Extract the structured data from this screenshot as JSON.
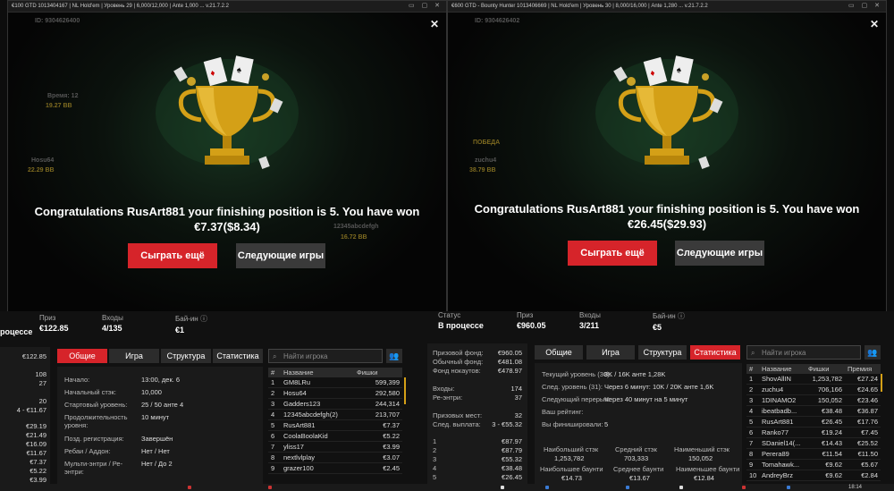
{
  "left_window": {
    "title": "€100 GTD 1013404167 | NL Hold'em | Уровень 29 | 6,000/12,000 | Ante 1,000 ... v.21.7.2.2",
    "id_text": "ID: 9304626400",
    "bg_labels": [
      "Время: 12",
      "19.27 BB",
      "Hosu64",
      "22.29 BB",
      "12345abcdefgh",
      "16.72 BB"
    ],
    "congrats_line1": "Congratulations RusArt881 your finishing position is 5. You have won",
    "congrats_line2": "€7.37($8.34)",
    "play_again": "Сыграть ещё",
    "next_games": "Следующие игры"
  },
  "right_window": {
    "title": "€600 GTD - Bounty Hunter 1013406669 | NL Hold'em | Уровень 30 | 8,000/16,000 | Ante 1,280 ... v.21.7.2.2",
    "id_text": "ID: 9304626402",
    "bg_labels": [
      "ПОБЕДА",
      "zuchu4",
      "38.79 BB"
    ],
    "congrats_line1": "Congratulations RusArt881 your finishing position is 5. You have won",
    "congrats_line2": "€26.45($29.93)",
    "play_again": "Сыграть ещё",
    "next_games": "Следующие игры"
  },
  "left_lobby": {
    "status_partial": "роцессе",
    "prize_label": "Приз",
    "prize_value": "€122.85",
    "entries_label": "Входы",
    "entries_value": "4/135",
    "buyin_label": "Бай-ин",
    "buyin_value": "€1",
    "side_values": [
      "€122.85",
      "108",
      "27",
      "20",
      "4 - €11.67",
      "€29.19",
      "€21.49",
      "€16.09",
      "€11.67",
      "€7.37",
      "€5.22",
      "€3.99"
    ],
    "tabs": [
      "Общие",
      "Игра",
      "Структура",
      "Статистика"
    ],
    "search_placeholder": "Найти игрока",
    "info": [
      [
        "Начало:",
        "13:00, дек. 6"
      ],
      [
        "Начальный стэк:",
        "10,000"
      ],
      [
        "Стартовый уровень:",
        "25 / 50 анте 4"
      ],
      [
        "Продолжительность уровня:",
        "10 минут"
      ],
      [
        "Позд. регистрация:",
        "Завершён"
      ],
      [
        "Ребаи / Аддон:",
        "Нет / Нет"
      ],
      [
        "Мульти-энтри / Ре-энтри:",
        "Нет / До 2"
      ]
    ],
    "table_headers": [
      "#",
      "Название",
      "Фишки"
    ],
    "players": [
      [
        "1",
        "GM8LRu",
        "599,399"
      ],
      [
        "2",
        "Hosu64",
        "292,580"
      ],
      [
        "3",
        "Gadders123",
        "244,314"
      ],
      [
        "4",
        "12345abcdefgh(2)",
        "213,707"
      ],
      [
        "5",
        "RusArt881",
        "€7.37"
      ],
      [
        "6",
        "CoolaBoolaKid",
        "€5.22"
      ],
      [
        "7",
        "yliss17",
        "€3.99"
      ],
      [
        "8",
        "nextlvlplay",
        "€3.07"
      ],
      [
        "9",
        "grazer100",
        "€2.45"
      ]
    ]
  },
  "right_lobby": {
    "status_label": "Статус",
    "status_value": "В процессе",
    "prize_label": "Приз",
    "prize_value": "€960.05",
    "entries_label": "Входы",
    "entries_value": "3/211",
    "buyin_label": "Бай-ин",
    "buyin_value": "€5",
    "left_panel": [
      [
        "Призовой фонд:",
        "€960.05"
      ],
      [
        "Обычный фонд:",
        "€481.08"
      ],
      [
        "Фонд нокаутов:",
        "€478.97"
      ],
      [
        "Входы:",
        "174"
      ],
      [
        "Ре-энтри:",
        "37"
      ],
      [
        "Призовых мест:",
        "32"
      ],
      [
        "След. выплата:",
        "3 - €55.32"
      ]
    ],
    "payouts": [
      [
        "1",
        "€87.97"
      ],
      [
        "2",
        "€87.79"
      ],
      [
        "3",
        "€55.32"
      ],
      [
        "4",
        "€38.48"
      ],
      [
        "5",
        "€26.45"
      ]
    ],
    "tabs": [
      "Общие",
      "Игра",
      "Структура",
      "Статистика"
    ],
    "search_placeholder": "Найти игрока",
    "stats": [
      [
        "Текущий уровень (30):",
        "8K / 16K анте 1,28K"
      ],
      [
        "След. уровень (31):",
        "Через 6 минут: 10K / 20K анте 1,6K"
      ],
      [
        "Следующий перерыв:",
        "Через 40 минут на 5 минут"
      ],
      [
        "Ваш рейтинг:",
        ""
      ],
      [
        "Вы финишировали:",
        "5"
      ]
    ],
    "stack_headers": [
      "Наибольший стэк",
      "Средний стэк",
      "Наименьший стэк"
    ],
    "stack_values": [
      "1,253,782",
      "703,333",
      "150,052"
    ],
    "bounty_headers": [
      "Наибольшее баунти",
      "Среднее баунти",
      "Наименьшее баунти"
    ],
    "bounty_values": [
      "€14.73",
      "€13.67",
      "€12.84"
    ],
    "table_headers": [
      "#",
      "Название",
      "Фишки",
      "Премия"
    ],
    "players": [
      [
        "1",
        "ShovAllIN",
        "1,253,782",
        "€27.24"
      ],
      [
        "2",
        "zuchu4",
        "706,166",
        "€24.65"
      ],
      [
        "3",
        "1DINAMO2",
        "150,052",
        "€23.46"
      ],
      [
        "4",
        "ibeatbadb...",
        "€38.48",
        "€36.87"
      ],
      [
        "5",
        "RusArt881",
        "€26.45",
        "€17.76"
      ],
      [
        "6",
        "Ranko77",
        "€19.24",
        "€7.45"
      ],
      [
        "7",
        "SDaniel14(...",
        "€14.43",
        "€25.52"
      ],
      [
        "8",
        "Perera89",
        "€11.54",
        "€11.50"
      ],
      [
        "9",
        "Tomahawk...",
        "€9.62",
        "€5.67"
      ],
      [
        "10",
        "AndreyBrz",
        "€9.62",
        "€2.84"
      ]
    ]
  },
  "taskbar": {
    "time": "18:14"
  }
}
